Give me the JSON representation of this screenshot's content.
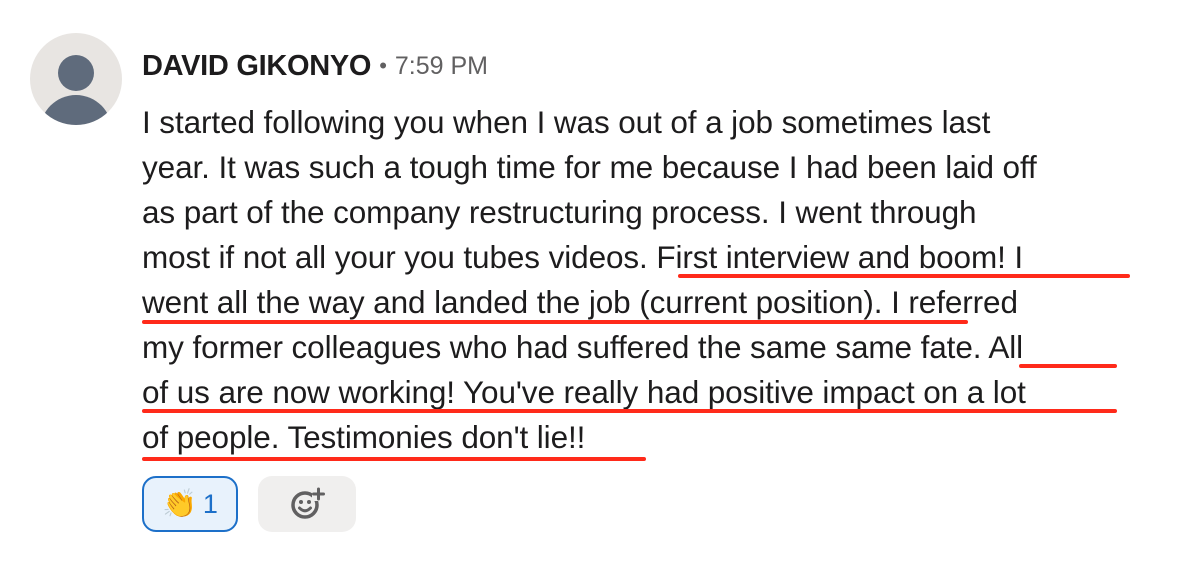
{
  "message": {
    "author": "DAVID GIKONYO",
    "separator": "•",
    "time": "7:59 PM",
    "lines": [
      "I started following you when I was out of a job sometimes last",
      "year. It was such a tough time for me because I had been laid off",
      "as part of the company restructuring process. I went through",
      "most if not all your you tubes videos. First interview and boom! I",
      "went all the way and landed the job (current position). I referred",
      "my former colleagues who had suffered the same same fate. All",
      "of us are now working! You've really had positive impact on a lot",
      "of people. Testimonies don't lie!!"
    ],
    "highlight_color": "#ff2a1a"
  },
  "reactions": [
    {
      "emoji": "👏",
      "icon": "clapping-hands-icon",
      "count": "1",
      "selected": true
    }
  ],
  "add_reaction": {
    "icon": "add-emoji-icon"
  }
}
